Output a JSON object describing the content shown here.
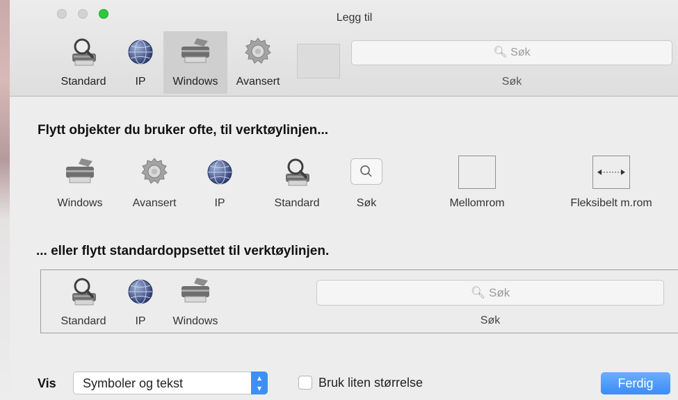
{
  "window": {
    "title": "Legg til",
    "traffic_lights": [
      "close",
      "minimize",
      "zoom"
    ]
  },
  "toolbar": {
    "items": [
      {
        "label": "Standard",
        "icon": "magnifier-printer-icon"
      },
      {
        "label": "IP",
        "icon": "globe-icon"
      },
      {
        "label": "Windows",
        "icon": "printer-icon",
        "selected": true
      },
      {
        "label": "Avansert",
        "icon": "gear-icon"
      }
    ],
    "search_placeholder": "Søk",
    "search_label": "Søk"
  },
  "palette": {
    "heading": "Flytt objekter du bruker ofte, til verktøylinjen...",
    "items": [
      {
        "label": "Windows",
        "icon": "printer-icon"
      },
      {
        "label": "Avansert",
        "icon": "gear-icon"
      },
      {
        "label": "IP",
        "icon": "globe-icon"
      },
      {
        "label": "Standard",
        "icon": "magnifier-printer-icon"
      },
      {
        "label": "Søk",
        "icon": "search-icon"
      },
      {
        "label": "Mellomrom",
        "icon": "space-icon"
      },
      {
        "label": "Fleksibelt m.rom",
        "icon": "flexible-space-icon"
      }
    ]
  },
  "default_set": {
    "heading": "... eller flytt standardoppsettet til verktøylinjen.",
    "items": [
      {
        "label": "Standard",
        "icon": "magnifier-printer-icon"
      },
      {
        "label": "IP",
        "icon": "globe-icon"
      },
      {
        "label": "Windows",
        "icon": "printer-icon"
      }
    ],
    "search_placeholder": "Søk",
    "search_label": "Søk"
  },
  "bottom": {
    "show_label": "Vis",
    "show_value": "Symboler og tekst",
    "small_size_label": "Bruk liten størrelse",
    "small_size_checked": false,
    "done_label": "Ferdig"
  },
  "colors": {
    "accent": "#3d8ff5",
    "zoom_green": "#2dc840"
  }
}
